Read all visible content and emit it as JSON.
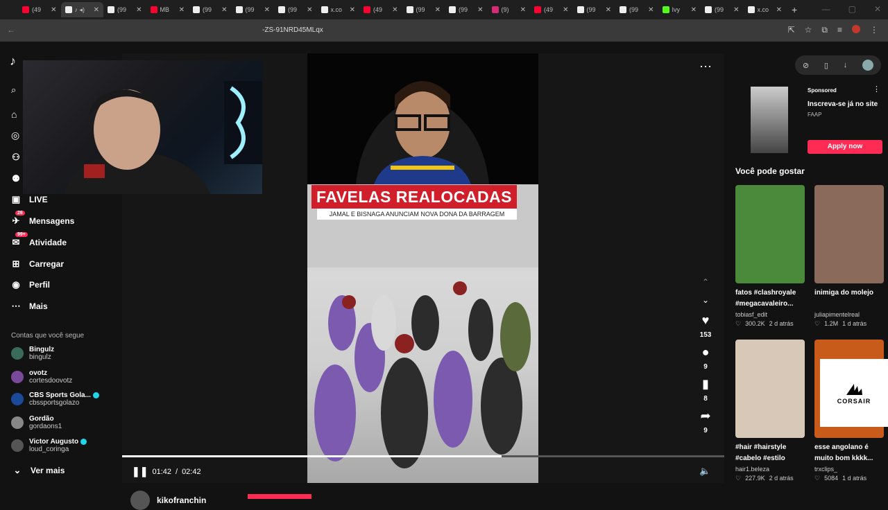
{
  "browser": {
    "tabs": [
      {
        "title": "(49",
        "color": "#ff0033"
      },
      {
        "title": "♪ ◂)",
        "color": "#eeeeee",
        "active": true
      },
      {
        "title": "(99",
        "color": "#eeeeee"
      },
      {
        "title": "MB",
        "color": "#ff0033"
      },
      {
        "title": "(99",
        "color": "#eeeeee"
      },
      {
        "title": "(99",
        "color": "#eeeeee"
      },
      {
        "title": "(99",
        "color": "#eeeeee"
      },
      {
        "title": "x.co",
        "color": "#eeeeee"
      },
      {
        "title": "(49",
        "color": "#ff0033"
      },
      {
        "title": "(99",
        "color": "#eeeeee"
      },
      {
        "title": "(99",
        "color": "#eeeeee"
      },
      {
        "title": "(9)",
        "color": "#d62976"
      },
      {
        "title": "(49",
        "color": "#ff0033"
      },
      {
        "title": "(99",
        "color": "#eeeeee"
      },
      {
        "title": "(99",
        "color": "#eeeeee"
      },
      {
        "title": "Ivy",
        "color": "#53fc18"
      },
      {
        "title": "(99",
        "color": "#eeeeee"
      },
      {
        "title": "x.co",
        "color": "#eeeeee"
      }
    ],
    "url": "-ZS-91NRD45MLqx"
  },
  "sidebar": {
    "nav": [
      {
        "label": "Seguindo",
        "icon": "following-icon"
      },
      {
        "label": "Amigos",
        "icon": "friends-icon"
      },
      {
        "label": "LIVE",
        "icon": "live-icon"
      },
      {
        "label": "Mensagens",
        "icon": "messages-icon",
        "badge": "26"
      },
      {
        "label": "Atividade",
        "icon": "activity-icon",
        "badge": "99+"
      },
      {
        "label": "Carregar",
        "icon": "upload-icon"
      },
      {
        "label": "Perfil",
        "icon": "profile-icon"
      },
      {
        "label": "Mais",
        "icon": "more-icon"
      }
    ],
    "following_title": "Contas que você segue",
    "accounts": [
      {
        "name": "Bingulz",
        "handle": "bingulz",
        "color": "#3a6b5a"
      },
      {
        "name": "ovotz",
        "handle": "cortesdoovotz",
        "color": "#7a4a9a"
      },
      {
        "name": "CBS Sports Gola...",
        "handle": "cbssportsgolazo",
        "color": "#1a4a9a",
        "verified": true
      },
      {
        "name": "Gordão",
        "handle": "gordaons1",
        "color": "#888888"
      },
      {
        "name": "Victor Augusto",
        "handle": "loud_coringa",
        "color": "#555555",
        "verified": true
      }
    ],
    "see_more": "Ver mais"
  },
  "video": {
    "headline": "FAVELAS REALOCADAS",
    "subheadline": "JAMAL E BISNAGA ANUNCIAM NOVA DONA DA BARRAGEM",
    "current_time": "01:42",
    "duration": "02:42",
    "progress": 0.63,
    "likes": "153",
    "comments": "9",
    "saves": "8",
    "shares": "9",
    "creator": "kikofranchin"
  },
  "ad": {
    "sponsored": "Sponsored",
    "title": "Inscreva-se já no site",
    "brand": "FAAP",
    "cta": "Apply now"
  },
  "recommendations": {
    "title": "Você pode gostar",
    "items": [
      {
        "caption": "fatos #clashroyale #megacavaleiro...",
        "author": "tobiasf_edit",
        "likes": "300.2K",
        "age": "2 d atrás",
        "color": "#4a8a3a"
      },
      {
        "caption": "inimiga do molejo",
        "author": "juliapimentelreal",
        "likes": "1.2M",
        "age": "1 d atrás",
        "color": "#8a6a5a"
      },
      {
        "caption": "#hair #hairstyle #cabelo #estilo",
        "author": "hair1.beleza",
        "likes": "227.9K",
        "age": "2 d atrás",
        "color": "#d8c8b8"
      },
      {
        "caption": "esse angolano é muito bom kkkk...",
        "author": "trxclips_",
        "likes": "5084",
        "age": "1 d atrás",
        "color": "#c85a1a"
      }
    ],
    "overlay_brand": "CORSAIR"
  }
}
